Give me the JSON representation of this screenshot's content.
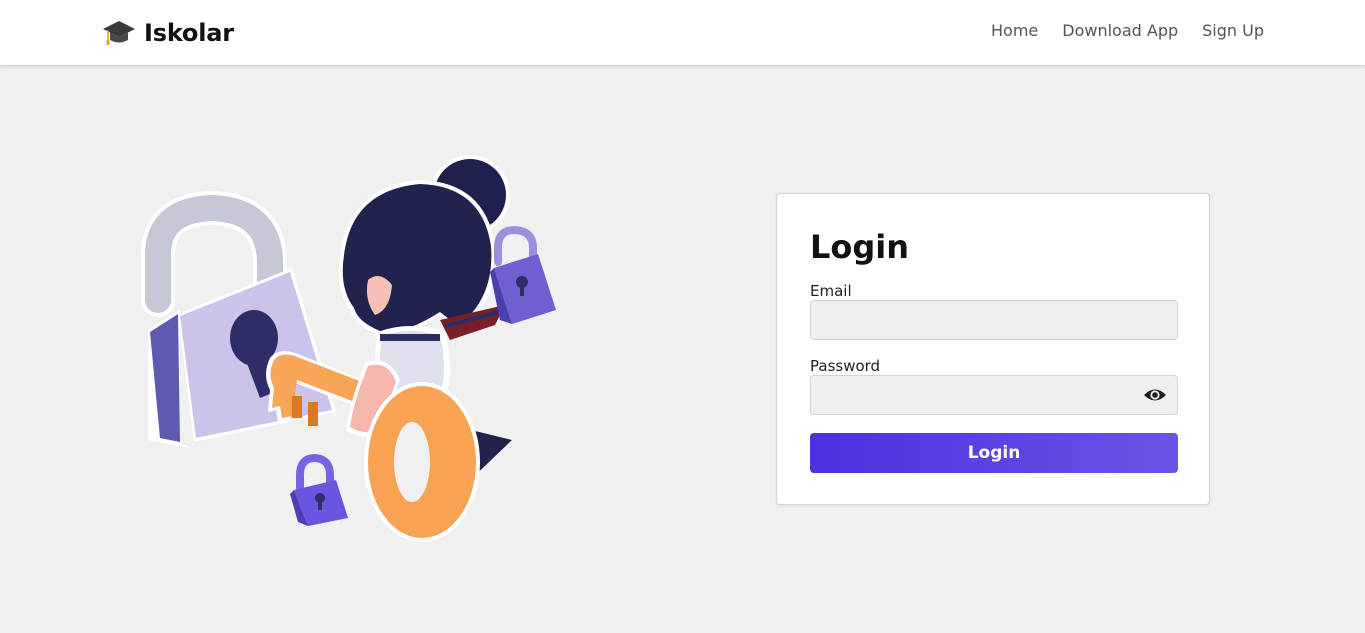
{
  "navbar": {
    "brand_name": "Iskolar",
    "brand_icon": "graduation-cap-icon",
    "links": [
      {
        "label": "Home"
      },
      {
        "label": "Download App"
      },
      {
        "label": "Sign Up"
      }
    ]
  },
  "login": {
    "title": "Login",
    "email_label": "Email",
    "email_value": "",
    "password_label": "Password",
    "password_value": "",
    "password_toggle_icon": "eye-icon",
    "submit_label": "Login"
  },
  "colors": {
    "accent_start": "#4a32df",
    "accent_end": "#6a55e6",
    "background": "#f0f0f0"
  }
}
